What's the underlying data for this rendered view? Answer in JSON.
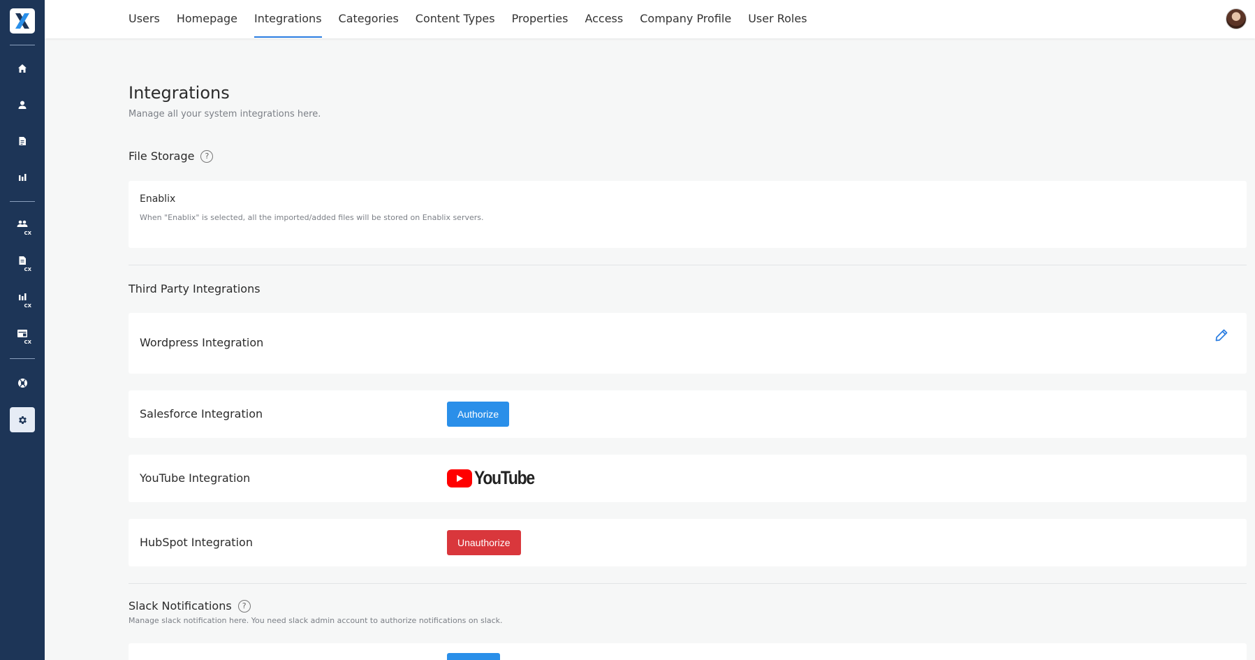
{
  "nav": {
    "items": [
      "Users",
      "Homepage",
      "Integrations",
      "Categories",
      "Content Types",
      "Properties",
      "Access",
      "Company Profile",
      "User Roles"
    ],
    "active": "Integrations"
  },
  "sidebar": {
    "icons": [
      "home-icon",
      "user-icon",
      "document-icon",
      "chart-icon",
      "team-cx-icon",
      "document-cx-icon",
      "chart-cx-icon",
      "card-cx-icon",
      "lifebuoy-icon",
      "gear-icon"
    ],
    "cx_badge": "CX",
    "active": "gear-icon"
  },
  "page": {
    "title": "Integrations",
    "subtitle": "Manage all your system integrations here."
  },
  "file_storage": {
    "title": "File Storage",
    "help_glyph": "?",
    "provider": "Enablix",
    "description": "When \"Enablix\" is selected, all the imported/added files will be stored on Enablix servers."
  },
  "third_party": {
    "title": "Third Party Integrations",
    "wordpress": {
      "label": "Wordpress Integration"
    },
    "salesforce": {
      "label": "Salesforce Integration",
      "button": "Authorize"
    },
    "youtube": {
      "label": "YouTube Integration",
      "logo_text": "YouTube"
    },
    "hubspot": {
      "label": "HubSpot Integration",
      "button": "Unauthorize"
    }
  },
  "slack": {
    "title": "Slack Notifications",
    "help_glyph": "?",
    "description": "Manage slack notification here. You need slack admin account to authorize notifications on slack."
  },
  "colors": {
    "sidebar": "#1d3557",
    "accent": "#2a7de1",
    "authorize": "#2a8fe9",
    "unauthorize": "#d9373c",
    "youtube_red": "#ff0000"
  }
}
